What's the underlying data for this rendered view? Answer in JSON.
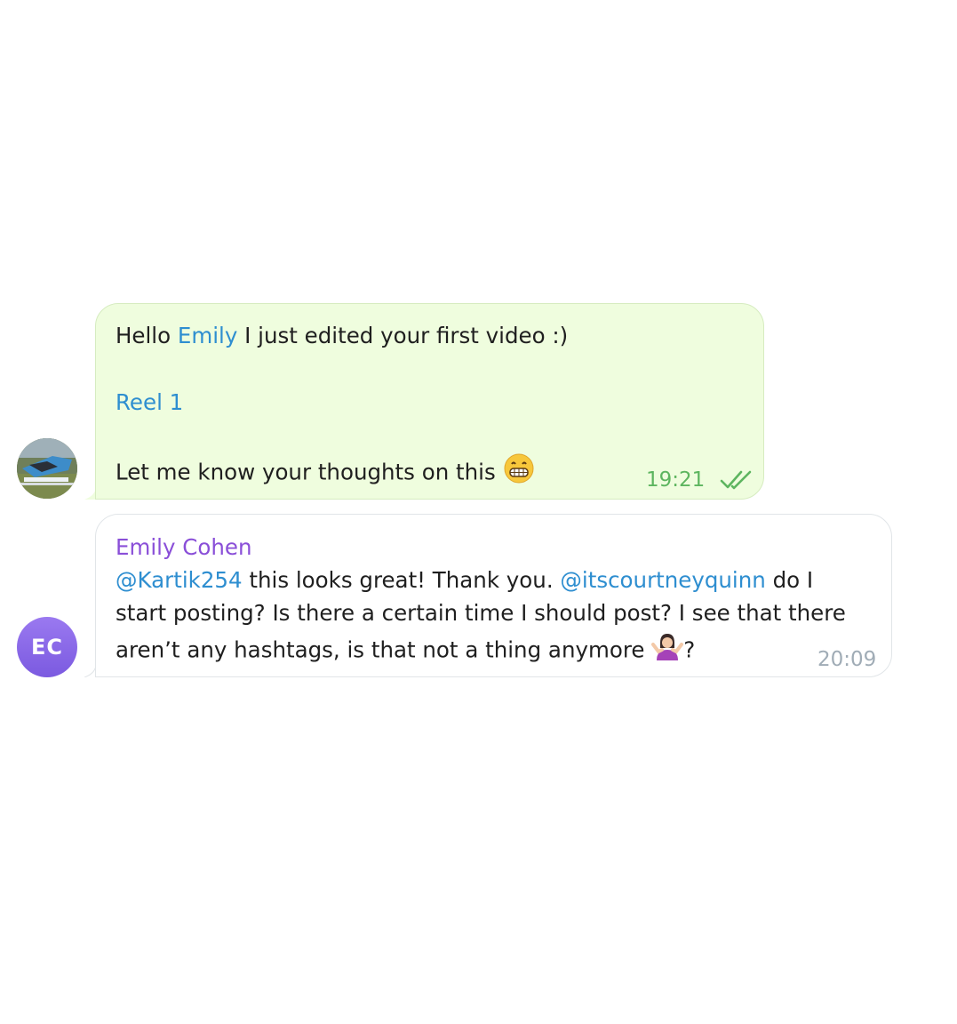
{
  "messages": [
    {
      "direction": "outgoing",
      "avatar_icon": "user-photo-avatar",
      "line1_prefix": "Hello ",
      "line1_mention": "Emily",
      "line1_suffix": " I just edited your first video :)",
      "link": "Reel 1",
      "line3": "Let me know your thoughts on this ",
      "emoji_icon": "grinning-face-emoji",
      "time": "19:21",
      "status_icon": "double-check-icon",
      "colors": {
        "bubble": "#effdde",
        "time": "#5db55f",
        "link": "#2e8ed0"
      }
    },
    {
      "direction": "incoming",
      "avatar_initials": "EC",
      "sender": "Emily Cohen",
      "mention1": "@Kartik254",
      "text1": " this looks great! Thank you. ",
      "mention2": "@itscourtneyquinn",
      "text2": " do I",
      "line2": "start posting? Is there a certain time I should post? I see that there",
      "line3": "aren’t any hashtags, is that not a thing anymore ",
      "emoji_icon": "woman-shrugging-emoji",
      "line3_end": "?",
      "time": "20:09",
      "colors": {
        "bubble": "#ffffff",
        "sender": "#8a4fd8",
        "time": "#a0acb6",
        "avatar": "#8866e8"
      }
    }
  ]
}
